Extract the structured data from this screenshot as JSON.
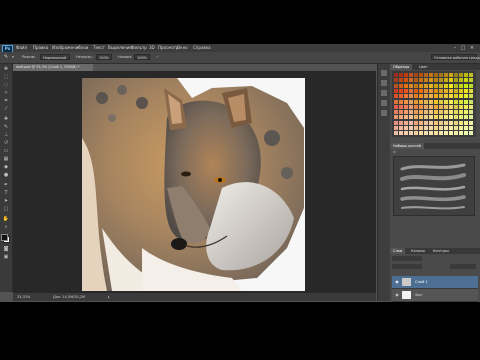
{
  "app": {
    "logo": "Ps"
  },
  "menu": [
    "Файл",
    "Правка",
    "Изображение",
    "Слои",
    "Текст",
    "Выделение",
    "Фильтр",
    "3D",
    "Просмотр",
    "Окно",
    "Справка"
  ],
  "options_bar": {
    "mode_label": "Режим:",
    "mode_value": "Нормальный",
    "opacity_label": "Непрозр.:",
    "opacity_value": "100%",
    "flow_label": "Нажим:",
    "flow_value": "100%",
    "workspace_value": "Основная рабочая среда"
  },
  "document": {
    "tab_title": "wolf.psd @ 33,3% (Слой 1, RGB/8) *",
    "zoom": "33,33%",
    "doc_size": "Док: 14,5M/30,2M"
  },
  "panels": {
    "swatches_tabs": [
      "Образцы",
      "Цвет"
    ],
    "brush_tabs": [
      "Наборы кистей"
    ],
    "layers_tabs": [
      "Слои",
      "Каналы",
      "Контуры"
    ],
    "layers": [
      {
        "name": "Слой 1",
        "selected": true
      },
      {
        "name": "Фон",
        "selected": false
      }
    ]
  },
  "colors": {
    "accent": "#4d6f94",
    "app_bg": "#535353",
    "canvas_bg": "#282828"
  }
}
